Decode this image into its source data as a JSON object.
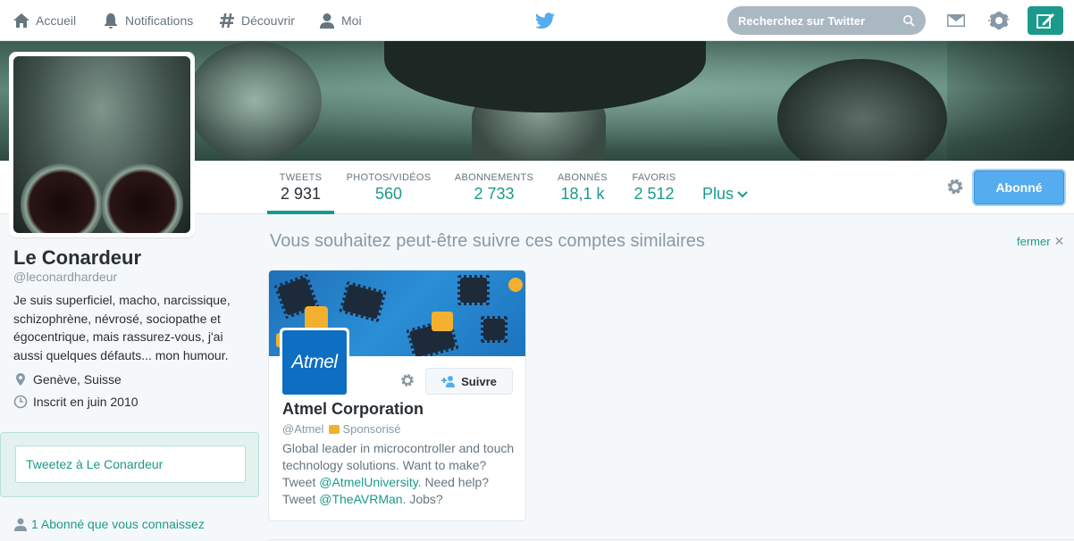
{
  "nav": {
    "home": "Accueil",
    "notifications": "Notifications",
    "discover": "Découvrir",
    "me": "Moi",
    "search_placeholder": "Recherchez sur Twitter"
  },
  "colors": {
    "accent": "#1b9a8b",
    "follow_button": "#55acee",
    "nav_text": "#66757f"
  },
  "icons": [
    "home-icon",
    "bell-icon",
    "hash-icon",
    "person-icon",
    "bird-icon",
    "search-icon",
    "envelope-icon",
    "gear-icon",
    "compose-icon"
  ],
  "stats": [
    {
      "label": "TWEETS",
      "value": "2 931"
    },
    {
      "label": "PHOTOS/VIDÉOS",
      "value": "560"
    },
    {
      "label": "ABONNEMENTS",
      "value": "2 733"
    },
    {
      "label": "ABONNÉS",
      "value": "18,1 k"
    },
    {
      "label": "FAVORIS",
      "value": "2 512"
    }
  ],
  "more_label": "Plus",
  "follow_button_label": "Abonné",
  "profile": {
    "name": "Le Conardeur",
    "handle": "@leconardhardeur",
    "bio": "Je suis superficiel, macho, narcissique, schizophrène, névrosé, sociopathe et égocentrique, mais rassurez-vous, j'ai aussi quelques défauts... mon humour.",
    "location": "Genève, Suisse",
    "joined": "Inscrit en juin 2010"
  },
  "tweet_to_label": "Tweetez à Le Conardeur",
  "known_followers": "1 Abonné que vous connaissez",
  "suggestions": {
    "title": "Vous souhaitez peut-être suivre ces comptes similaires",
    "close_label": "fermer",
    "card": {
      "logo_text": "Atmel",
      "follow_label": "Suivre",
      "name": "Atmel Corporation",
      "handle": "@Atmel",
      "promoted": "Sponsorisé",
      "bio_1": "Global leader in microcontroller and touch technology solutions. Want to make? Tweet ",
      "bio_link_1": "@AtmelUniversity",
      "bio_2": ". Need help? Tweet ",
      "bio_link_2": "@TheAVRMan",
      "bio_3": ". Jobs?"
    }
  }
}
